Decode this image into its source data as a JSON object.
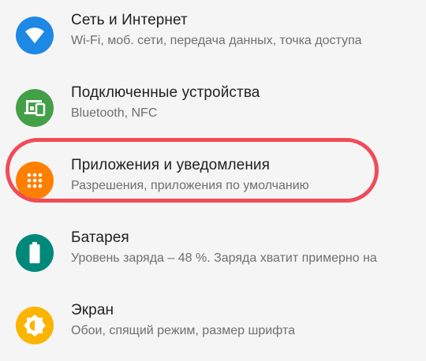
{
  "settings": {
    "items": [
      {
        "title": "Сеть и Интернет",
        "subtitle": "Wi-Fi, моб. сети, передача данных, точка доступа",
        "icon": "wifi-icon",
        "color": "#1e88e5"
      },
      {
        "title": "Подключенные устройства",
        "subtitle": "Bluetooth, NFC",
        "icon": "devices-icon",
        "color": "#43a047"
      },
      {
        "title": "Приложения и уведомления",
        "subtitle": "Разрешения, приложения по умолчанию",
        "icon": "apps-icon",
        "color": "#ff7f00"
      },
      {
        "title": "Батарея",
        "subtitle": "Уровень заряда – 48 %. Заряда хватит примерно на",
        "icon": "battery-icon",
        "color": "#00897b"
      },
      {
        "title": "Экран",
        "subtitle": "Обои, спящий режим, размер шрифта",
        "icon": "brightness-icon",
        "color": "#fbb400"
      }
    ]
  },
  "highlight": {
    "color": "#ef4b59"
  }
}
